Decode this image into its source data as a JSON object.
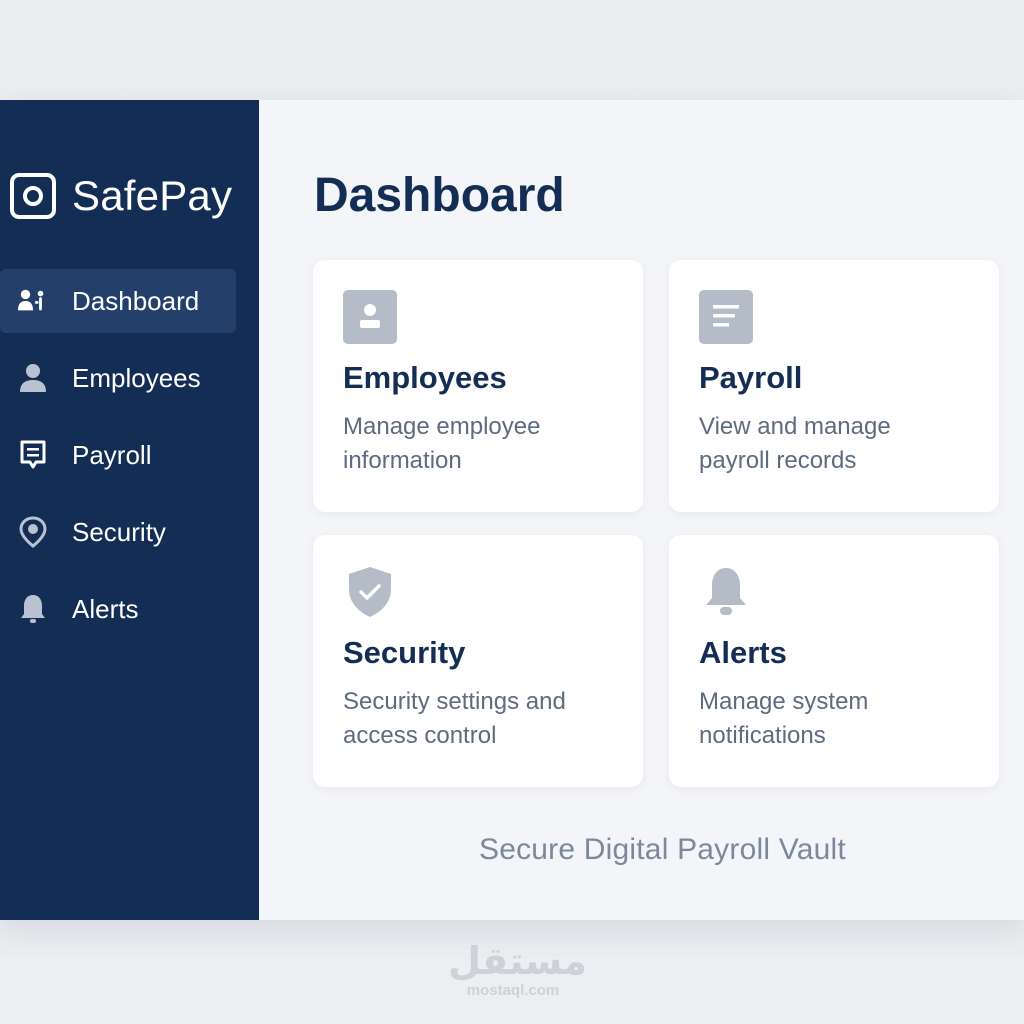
{
  "brand": {
    "name": "SafePay",
    "logo_icon": "vault-icon"
  },
  "sidebar": {
    "items": [
      {
        "label": "Dashboard",
        "icon": "users-icon",
        "active": true
      },
      {
        "label": "Employees",
        "icon": "user-icon",
        "active": false
      },
      {
        "label": "Payroll",
        "icon": "document-icon",
        "active": false
      },
      {
        "label": "Security",
        "icon": "location-pin-icon",
        "active": false
      },
      {
        "label": "Alerts",
        "icon": "bell-icon",
        "active": false
      }
    ]
  },
  "main": {
    "title": "Dashboard",
    "cards": [
      {
        "title": "Employees",
        "description": "Manage employee information",
        "icon": "user-badge-icon"
      },
      {
        "title": "Payroll",
        "description": "View and manage payroll records",
        "icon": "document-icon"
      },
      {
        "title": "Security",
        "description": "Security settings and access control",
        "icon": "shield-check-icon"
      },
      {
        "title": "Alerts",
        "description": "Manage system notifications",
        "icon": "bell-icon"
      }
    ],
    "footer": "Secure Digital Payroll Vault"
  },
  "watermark": {
    "arabic": "مستقل",
    "url": "mostaql.com"
  },
  "colors": {
    "sidebar_bg": "#142d55",
    "sidebar_active_bg": "#24406a",
    "title_text": "#142d55",
    "muted_text": "#5d6b80",
    "icon_gray": "#b4bcc8"
  }
}
